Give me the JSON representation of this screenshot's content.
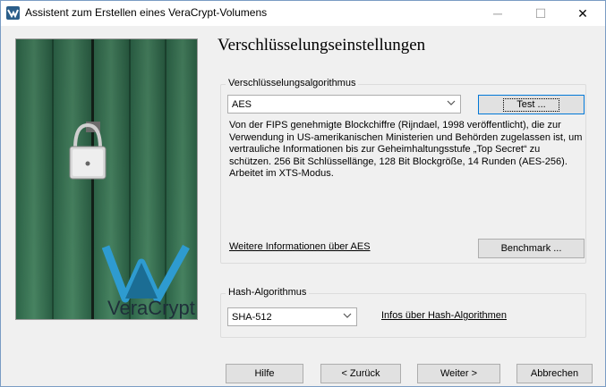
{
  "window": {
    "title": "Assistent zum Erstellen eines VeraCrypt-Volumens",
    "minimize_glyph": "─",
    "maximize_glyph": "☐",
    "close_glyph": "✕"
  },
  "sidebar": {
    "brand_text": "VeraCrypt",
    "icon": "veracrypt-logo"
  },
  "page": {
    "title": "Verschlüsselungseinstellungen"
  },
  "encryption": {
    "group_label": "Verschlüsselungsalgorithmus",
    "selected_algorithm": "AES",
    "test_button": "Test ...",
    "description": "Von der FIPS genehmigte Blockchiffre (Rijndael, 1998 veröffentlicht), die zur Verwendung in US-amerikanischen Ministerien und Behörden zugelassen ist, um vertrauliche Informationen bis zur Geheimhaltungsstufe „Top Secret“ zu schützen. 256 Bit Schlüssellänge, 128 Bit Blockgröße, 14 Runden (AES-256). Arbeitet im XTS-Modus.",
    "more_info_link": "Weitere Informationen über AES",
    "benchmark_button": "Benchmark ..."
  },
  "hash": {
    "group_label": "Hash-Algorithmus",
    "selected_algorithm": "SHA-512",
    "info_link": "Infos über Hash-Algorithmen"
  },
  "footer": {
    "help_button": "Hilfe",
    "back_button": "< Zurück",
    "next_button": "Weiter >",
    "cancel_button": "Abbrechen"
  }
}
